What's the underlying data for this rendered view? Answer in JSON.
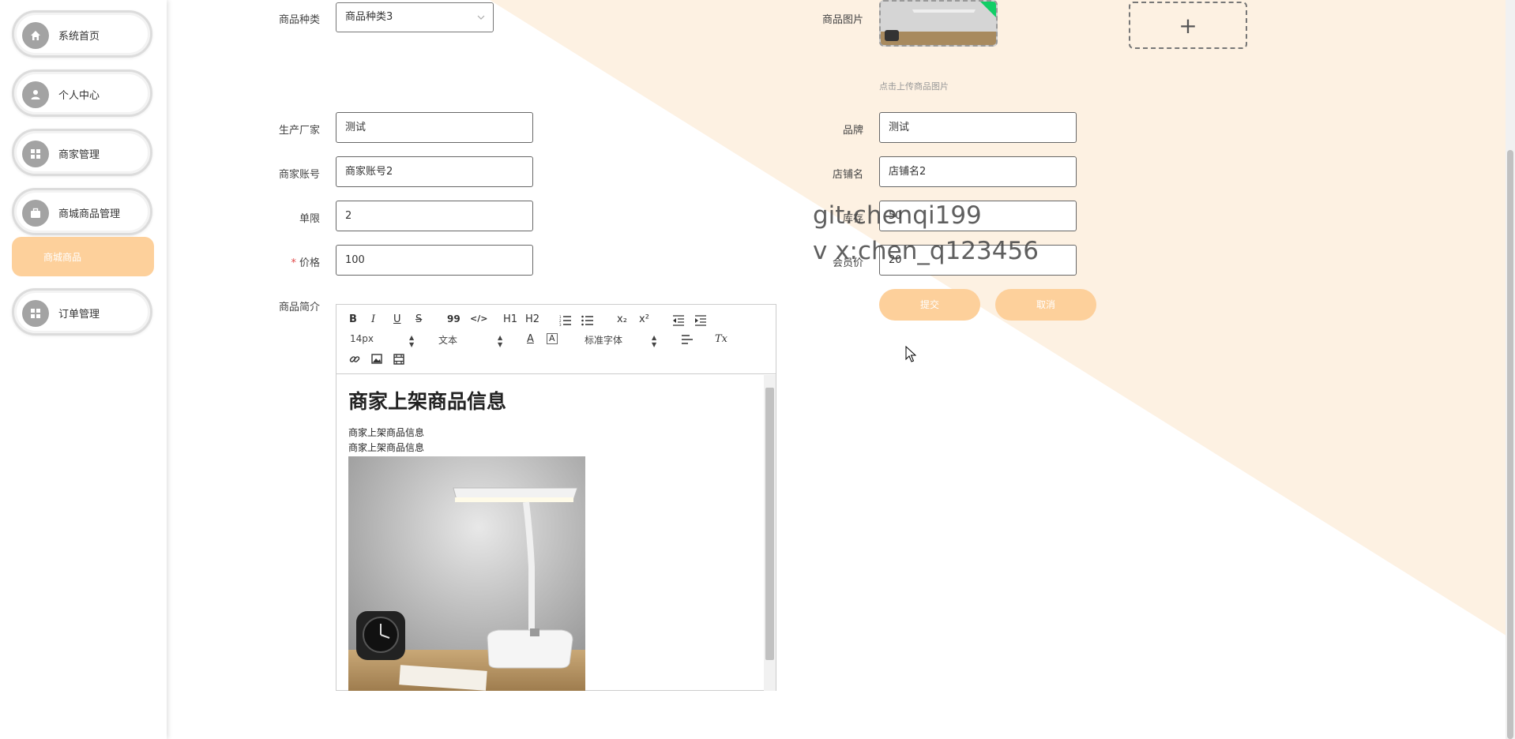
{
  "sidebar": {
    "items": [
      {
        "label": "系统首页",
        "icon": "home-icon"
      },
      {
        "label": "个人中心",
        "icon": "user-icon"
      },
      {
        "label": "商家管理",
        "icon": "grid-icon"
      },
      {
        "label": "商城商品管理",
        "icon": "briefcase-icon"
      },
      {
        "label": "订单管理",
        "icon": "grid-icon"
      }
    ],
    "submenu_label": "商城商品"
  },
  "form": {
    "category": {
      "label": "商品种类",
      "value": "商品种类3"
    },
    "image": {
      "label": "商品图片",
      "hint": "点击上传商品图片",
      "add": "+"
    },
    "manufacturer": {
      "label": "生产厂家",
      "value": "测试"
    },
    "brand": {
      "label": "品牌",
      "value": "测试"
    },
    "merchant_account": {
      "label": "商家账号",
      "value": "商家账号2"
    },
    "shop_name": {
      "label": "店铺名",
      "value": "店铺名2"
    },
    "limit": {
      "label": "单限",
      "value": "2"
    },
    "stock": {
      "label": "库存",
      "value": "50"
    },
    "price": {
      "label": "价格",
      "required": "*",
      "value": "100"
    },
    "member_price": {
      "label": "会员价",
      "value": "20"
    },
    "intro": {
      "label": "商品简介"
    }
  },
  "buttons": {
    "submit": "提交",
    "cancel": "取消"
  },
  "editor": {
    "toolbar": {
      "bold": "B",
      "italic": "I",
      "underline": "U",
      "strike": "S",
      "quote": "99",
      "code": "</>",
      "h1": "H1",
      "h2": "H2",
      "sub": "x₂",
      "sup": "x²",
      "font_size": "14px",
      "text_type": "文本",
      "font_family": "标准字体",
      "clear": "Tx"
    },
    "heading": "商家上架商品信息",
    "lines": [
      "商家上架商品信息",
      "商家上架商品信息"
    ]
  },
  "watermark": {
    "line1": "git:chenqi199",
    "line2": "v x:chen_q123456"
  },
  "colors": {
    "accent": "#fdd09b",
    "bg_triangle": "#fdf0e0",
    "icon_gray": "#a3a3a3"
  }
}
